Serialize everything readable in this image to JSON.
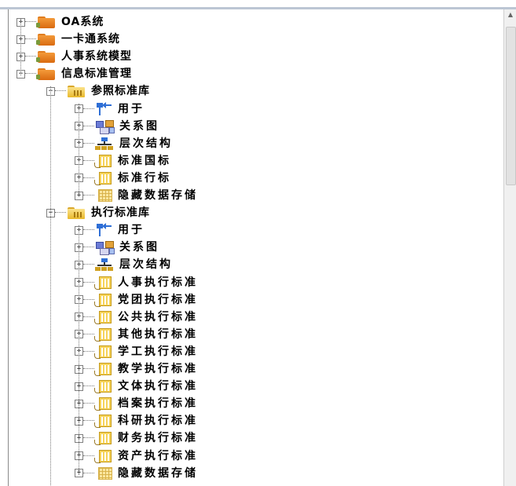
{
  "tree": {
    "top_level": [
      {
        "label": "OA系统",
        "expander": "+"
      },
      {
        "label": "一卡通系统",
        "expander": "+"
      },
      {
        "label": "人事系统模型",
        "expander": "+"
      },
      {
        "label": "信息标准管理",
        "expander": "-"
      }
    ],
    "ref_lib": {
      "label": "参照标准库",
      "expander": "-",
      "children": [
        {
          "label": "用于",
          "icon": "arrow"
        },
        {
          "label": "关系图",
          "icon": "relation"
        },
        {
          "label": "层次结构",
          "icon": "hierarchy"
        },
        {
          "label": "标准国标",
          "icon": "table"
        },
        {
          "label": "标准行标",
          "icon": "table"
        },
        {
          "label": "隐藏数据存储",
          "icon": "grid"
        }
      ]
    },
    "exec_lib": {
      "label": "执行标准库",
      "expander": "-",
      "children": [
        {
          "label": "用于",
          "icon": "arrow"
        },
        {
          "label": "关系图",
          "icon": "relation"
        },
        {
          "label": "层次结构",
          "icon": "hierarchy"
        },
        {
          "label": "人事执行标准",
          "icon": "table"
        },
        {
          "label": "党团执行标准",
          "icon": "table"
        },
        {
          "label": "公共执行标准",
          "icon": "table"
        },
        {
          "label": "其他执行标准",
          "icon": "table"
        },
        {
          "label": "学工执行标准",
          "icon": "table"
        },
        {
          "label": "教学执行标准",
          "icon": "table"
        },
        {
          "label": "文体执行标准",
          "icon": "table"
        },
        {
          "label": "档案执行标准",
          "icon": "table"
        },
        {
          "label": "科研执行标准",
          "icon": "table"
        },
        {
          "label": "财务执行标准",
          "icon": "table"
        },
        {
          "label": "资产执行标准",
          "icon": "table"
        },
        {
          "label": "隐藏数据存储",
          "icon": "grid"
        }
      ]
    }
  },
  "colors": {
    "folder_orange": "#f39a3a",
    "folder_yellow": "#f6d35a",
    "link_blue": "#2f6fd6"
  }
}
